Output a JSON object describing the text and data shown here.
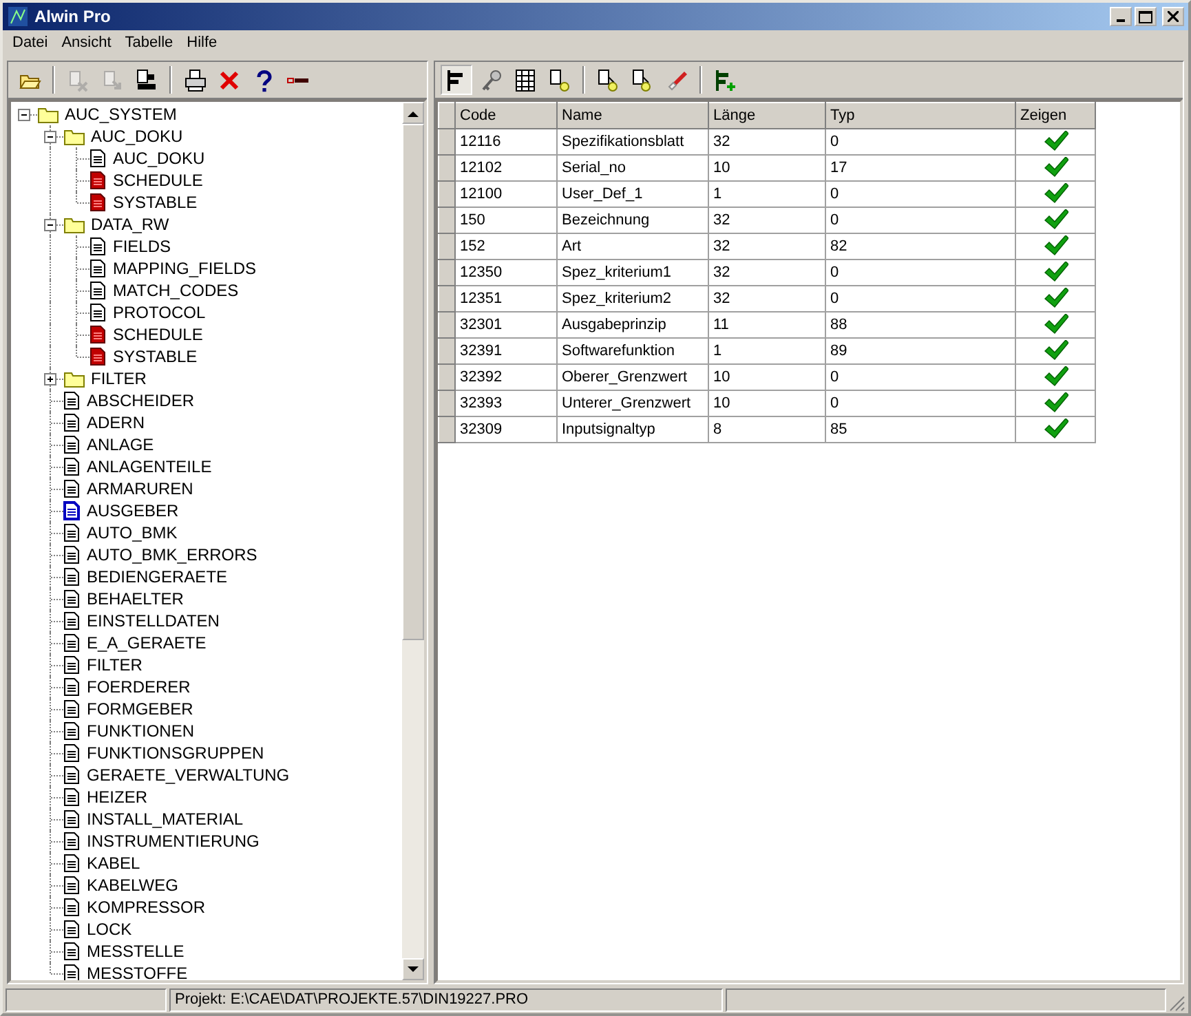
{
  "window": {
    "title": "Alwin Pro"
  },
  "menu": [
    "Datei",
    "Ansicht",
    "Tabelle",
    "Hilfe"
  ],
  "left_toolbar": [
    {
      "disabled": false
    },
    {
      "disabled": true
    },
    {
      "disabled": true
    },
    {
      "disabled": false
    },
    {
      "disabled": false
    },
    {
      "disabled": false
    },
    {
      "disabled": false
    },
    {
      "disabled": false
    }
  ],
  "tree": [
    {
      "label": "AUC_SYSTEM",
      "kind": "folder",
      "selected": false,
      "expanded": true,
      "children": [
        {
          "label": "AUC_DOKU",
          "kind": "folder",
          "selected": false,
          "expanded": true,
          "children": [
            {
              "label": "AUC_DOKU",
              "kind": "table",
              "selected": false
            },
            {
              "label": "SCHEDULE",
              "kind": "system",
              "selected": false
            },
            {
              "label": "SYSTABLE",
              "kind": "system",
              "selected": false
            }
          ]
        },
        {
          "label": "DATA_RW",
          "kind": "folder",
          "selected": false,
          "expanded": true,
          "children": [
            {
              "label": "FIELDS",
              "kind": "table",
              "selected": false
            },
            {
              "label": "MAPPING_FIELDS",
              "kind": "table",
              "selected": false
            },
            {
              "label": "MATCH_CODES",
              "kind": "table",
              "selected": false
            },
            {
              "label": "PROTOCOL",
              "kind": "table",
              "selected": false
            },
            {
              "label": "SCHEDULE",
              "kind": "system",
              "selected": false
            },
            {
              "label": "SYSTABLE",
              "kind": "system",
              "selected": false
            }
          ]
        },
        {
          "label": "FILTER",
          "kind": "folder",
          "selected": false,
          "expanded": false
        },
        {
          "label": "ABSCHEIDER",
          "kind": "table",
          "selected": false
        },
        {
          "label": "ADERN",
          "kind": "table",
          "selected": false
        },
        {
          "label": "ANLAGE",
          "kind": "table",
          "selected": false
        },
        {
          "label": "ANLAGENTEILE",
          "kind": "table",
          "selected": false
        },
        {
          "label": "ARMARUREN",
          "kind": "table",
          "selected": false
        },
        {
          "label": "AUSGEBER",
          "kind": "table",
          "selected": true
        },
        {
          "label": "AUTO_BMK",
          "kind": "table",
          "selected": false
        },
        {
          "label": "AUTO_BMK_ERRORS",
          "kind": "table",
          "selected": false
        },
        {
          "label": "BEDIENGERAETE",
          "kind": "table",
          "selected": false
        },
        {
          "label": "BEHAELTER",
          "kind": "table",
          "selected": false
        },
        {
          "label": "EINSTELLDATEN",
          "kind": "table",
          "selected": false
        },
        {
          "label": "E_A_GERAETE",
          "kind": "table",
          "selected": false
        },
        {
          "label": "FILTER",
          "kind": "table",
          "selected": false
        },
        {
          "label": "FOERDERER",
          "kind": "table",
          "selected": false
        },
        {
          "label": "FORMGEBER",
          "kind": "table",
          "selected": false
        },
        {
          "label": "FUNKTIONEN",
          "kind": "table",
          "selected": false
        },
        {
          "label": "FUNKTIONSGRUPPEN",
          "kind": "table",
          "selected": false
        },
        {
          "label": "GERAETE_VERWALTUNG",
          "kind": "table",
          "selected": false
        },
        {
          "label": "HEIZER",
          "kind": "table",
          "selected": false
        },
        {
          "label": "INSTALL_MATERIAL",
          "kind": "table",
          "selected": false
        },
        {
          "label": "INSTRUMENTIERUNG",
          "kind": "table",
          "selected": false
        },
        {
          "label": "KABEL",
          "kind": "table",
          "selected": false
        },
        {
          "label": "KABELWEG",
          "kind": "table",
          "selected": false
        },
        {
          "label": "KOMPRESSOR",
          "kind": "table",
          "selected": false
        },
        {
          "label": "LOCK",
          "kind": "table",
          "selected": false
        },
        {
          "label": "MESSTELLE",
          "kind": "table",
          "selected": false
        },
        {
          "label": "MESSTOFFE",
          "kind": "table",
          "selected": false
        }
      ]
    }
  ],
  "table": {
    "columns": [
      "Code",
      "Name",
      "Länge",
      "Typ",
      "Zeigen"
    ],
    "rows": [
      {
        "cells": [
          "12116",
          "Spezifikationsblatt",
          "32",
          "0"
        ],
        "shown": true
      },
      {
        "cells": [
          "12102",
          "Serial_no",
          "10",
          "17"
        ],
        "shown": true
      },
      {
        "cells": [
          "12100",
          "User_Def_1",
          "1",
          "0"
        ],
        "shown": true
      },
      {
        "cells": [
          "150",
          "Bezeichnung",
          "32",
          "0"
        ],
        "shown": true
      },
      {
        "cells": [
          "152",
          "Art",
          "32",
          "82"
        ],
        "shown": true
      },
      {
        "cells": [
          "12350",
          "Spez_kriterium1",
          "32",
          "0"
        ],
        "shown": true
      },
      {
        "cells": [
          "12351",
          "Spez_kriterium2",
          "32",
          "0"
        ],
        "shown": true
      },
      {
        "cells": [
          "32301",
          "Ausgabeprinzip",
          "11",
          "88"
        ],
        "shown": true
      },
      {
        "cells": [
          "32391",
          "Softwarefunktion",
          "1",
          "89"
        ],
        "shown": true
      },
      {
        "cells": [
          "32392",
          "Oberer_Grenzwert",
          "10",
          "0"
        ],
        "shown": true
      },
      {
        "cells": [
          "32393",
          "Unterer_Grenzwert",
          "10",
          "0"
        ],
        "shown": true
      },
      {
        "cells": [
          "32309",
          "Inputsignaltyp",
          "8",
          "85"
        ],
        "shown": true
      }
    ]
  },
  "status_bar": {
    "project": "Projekt: E:\\CAE\\DAT\\PROJEKTE.57\\DIN19227.PRO"
  }
}
